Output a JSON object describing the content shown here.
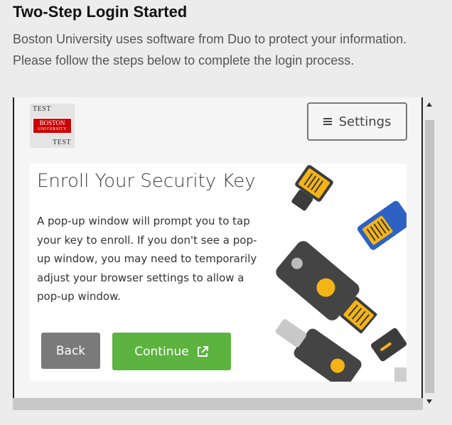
{
  "page": {
    "title": "Two-Step Login Started",
    "description": "Boston University uses software from Duo to protect your information. Please follow the steps below to complete the login process."
  },
  "logo": {
    "top_text": "TEST",
    "name_line1": "BOSTON",
    "name_line2": "UNIVERSITY",
    "bottom_text": "TEST",
    "brand_color": "#cc0000"
  },
  "settings": {
    "label": "Settings",
    "icon": "hamburger-icon"
  },
  "enroll": {
    "title": "Enroll Your Security Key",
    "body": "A pop-up window will prompt you to tap your key to enroll. If you don't see a pop-up window, you may need to temporarily adjust your browser settings to allow a pop-up window.",
    "back_label": "Back",
    "continue_label": "Continue",
    "continue_icon": "external-link-icon",
    "illustration": "security-keys-illustration"
  },
  "colors": {
    "continue": "#5cb33f",
    "back": "#7a7a7a",
    "key_yellow": "#f5b416",
    "key_blue": "#2d62c4",
    "key_dark": "#3c3c3c"
  }
}
